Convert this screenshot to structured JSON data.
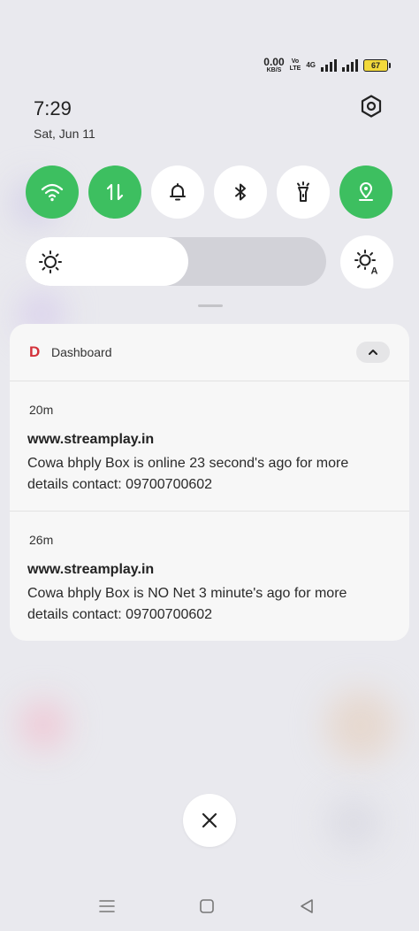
{
  "statusbar": {
    "speed_value": "0.00",
    "speed_unit": "KB/S",
    "volte_top": "Vo",
    "volte_mid": "LTE",
    "volte_bot": "",
    "network": "4G",
    "battery": "67",
    "battery_color": "#f2d93b"
  },
  "header": {
    "time": "7:29",
    "date": "Sat, Jun 11"
  },
  "quick_settings": {
    "accent": "#3dbf60",
    "tiles": [
      {
        "icon": "wifi-icon",
        "active": true
      },
      {
        "icon": "mobile-data-icon",
        "active": true
      },
      {
        "icon": "bell-icon",
        "active": false
      },
      {
        "icon": "bluetooth-icon",
        "active": false
      },
      {
        "icon": "flashlight-icon",
        "active": false
      },
      {
        "icon": "location-icon",
        "active": true
      }
    ],
    "brightness_level": 0.54
  },
  "notification": {
    "app_name": "Dashboard",
    "app_icon_letter": "D",
    "app_icon_color": "#d3313a",
    "items": [
      {
        "age": "20m",
        "title": "www.streamplay.in",
        "body": "Cowa bhply Box is online 23 second's ago for more details contact: 09700700602"
      },
      {
        "age": "26m",
        "title": "www.streamplay.in",
        "body": "Cowa bhply Box is NO Net 3 minute's ago for more details contact: 09700700602"
      }
    ]
  },
  "nav": {
    "buttons": [
      "recents-icon",
      "home-icon",
      "back-icon"
    ]
  }
}
